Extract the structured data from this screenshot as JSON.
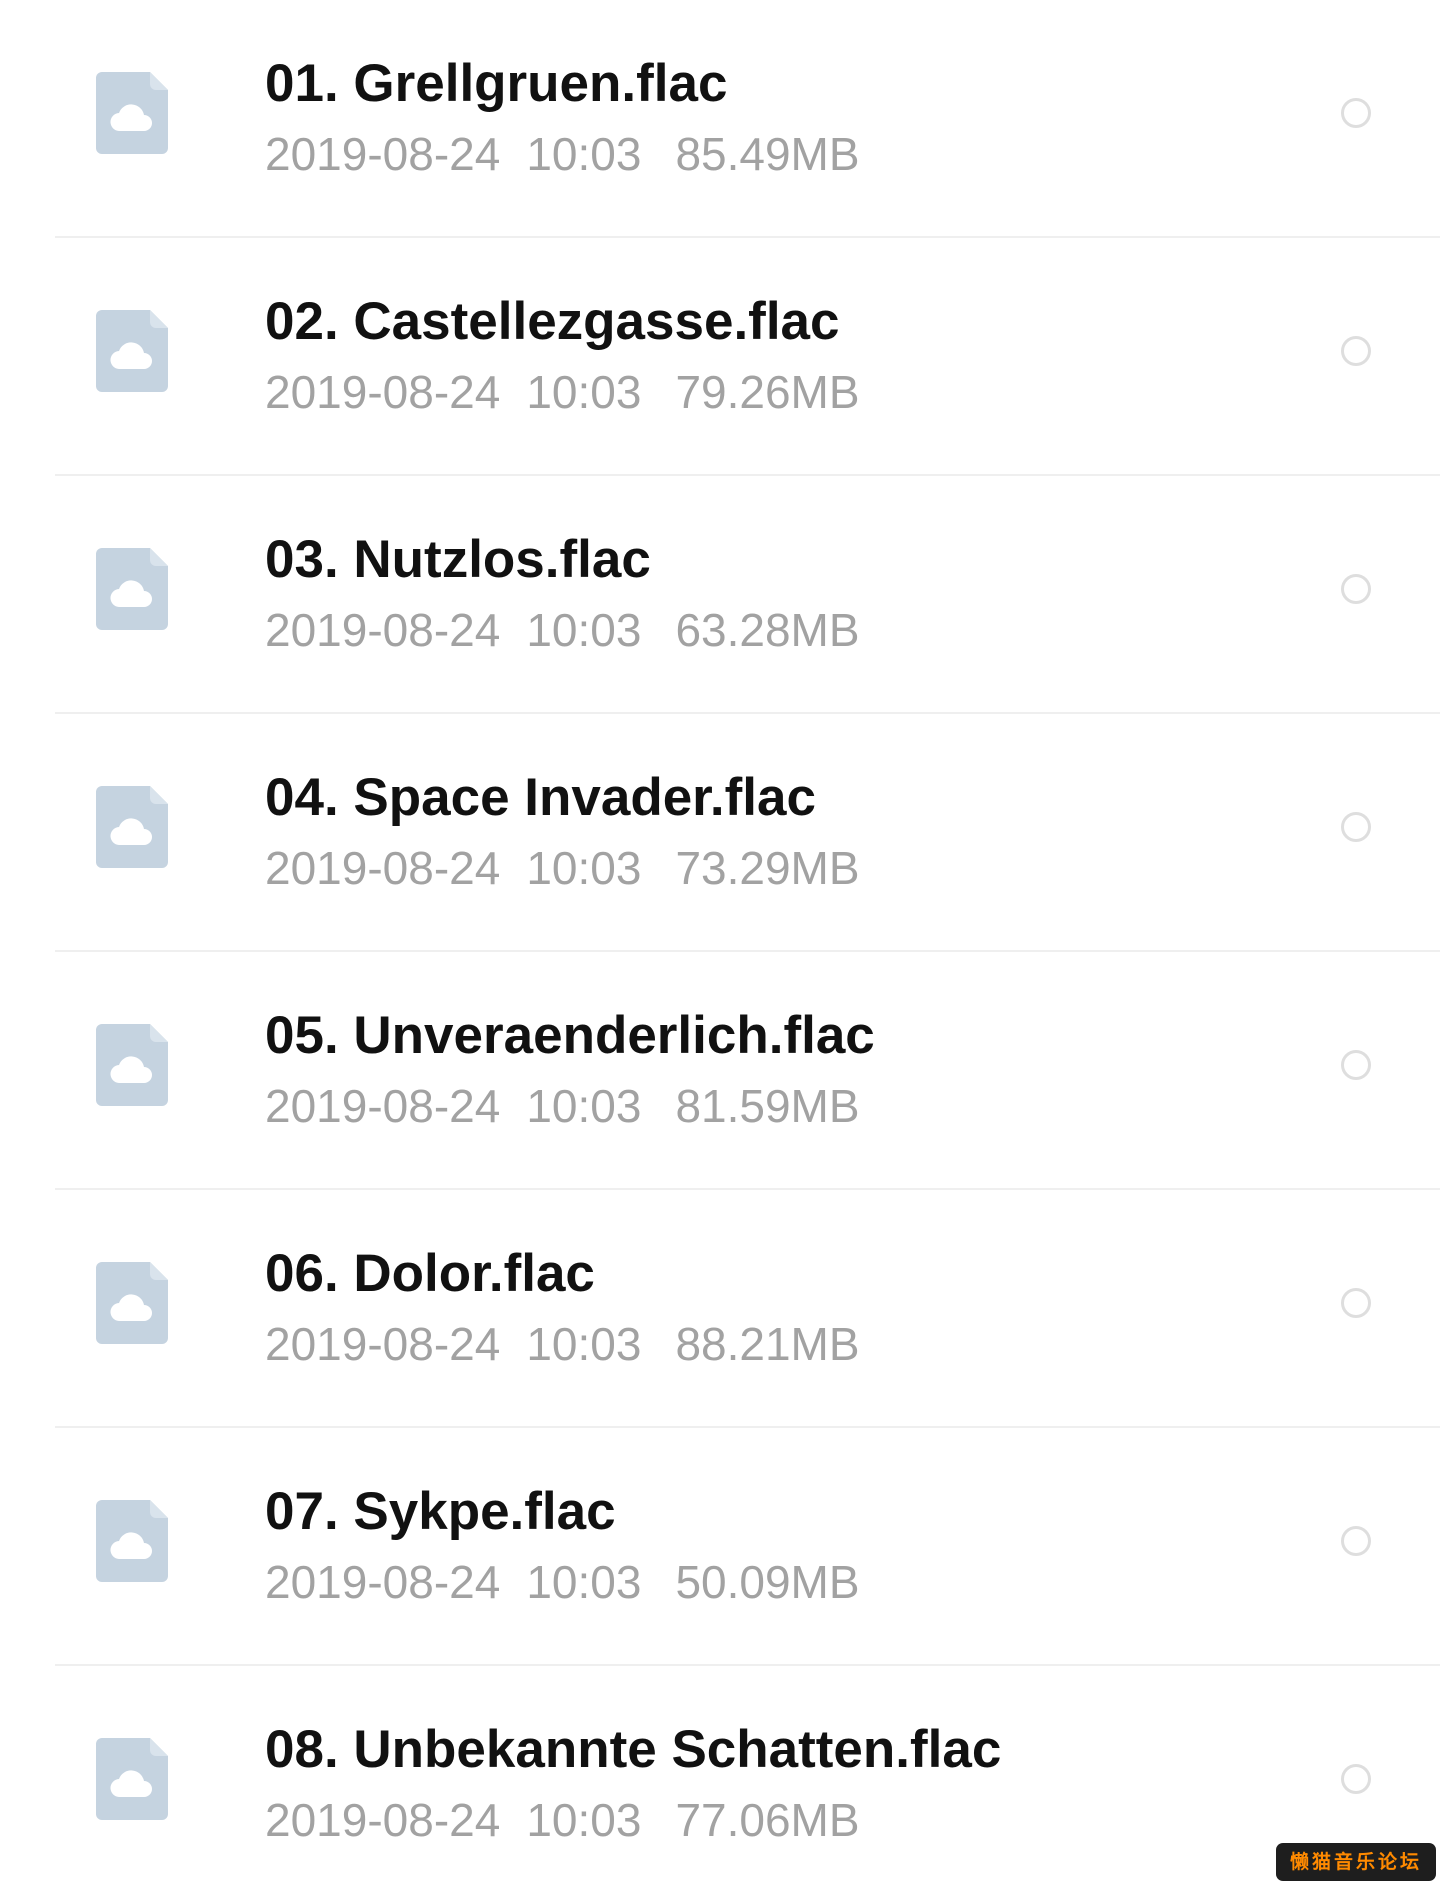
{
  "files": [
    {
      "name": "01. Grellgruen.flac",
      "date": "2019-08-24",
      "time": "10:03",
      "size": "85.49MB",
      "icon": "cloud-file-icon",
      "selected": false
    },
    {
      "name": "02. Castellezgasse.flac",
      "date": "2019-08-24",
      "time": "10:03",
      "size": "79.26MB",
      "icon": "cloud-file-icon",
      "selected": false
    },
    {
      "name": "03. Nutzlos.flac",
      "date": "2019-08-24",
      "time": "10:03",
      "size": "63.28MB",
      "icon": "cloud-file-icon",
      "selected": false
    },
    {
      "name": "04. Space Invader.flac",
      "date": "2019-08-24",
      "time": "10:03",
      "size": "73.29MB",
      "icon": "cloud-file-icon",
      "selected": false
    },
    {
      "name": "05. Unveraenderlich.flac",
      "date": "2019-08-24",
      "time": "10:03",
      "size": "81.59MB",
      "icon": "cloud-file-icon",
      "selected": false
    },
    {
      "name": "06. Dolor.flac",
      "date": "2019-08-24",
      "time": "10:03",
      "size": "88.21MB",
      "icon": "cloud-file-icon",
      "selected": false
    },
    {
      "name": "07. Sykpe.flac",
      "date": "2019-08-24",
      "time": "10:03",
      "size": "50.09MB",
      "icon": "cloud-file-icon",
      "selected": false
    },
    {
      "name": "08. Unbekannte Schatten.flac",
      "date": "2019-08-24",
      "time": "10:03",
      "size": "77.06MB",
      "icon": "cloud-file-icon",
      "selected": false
    }
  ],
  "watermark": "懒猫音乐论坛",
  "colors": {
    "icon_fill": "#c5d3e0",
    "title_text": "#111111",
    "meta_text": "#a2a2a2",
    "divider": "#efefef",
    "radio_border": "#dedede",
    "watermark_bg": "#1e1e1e",
    "watermark_text": "#ff8a00"
  }
}
